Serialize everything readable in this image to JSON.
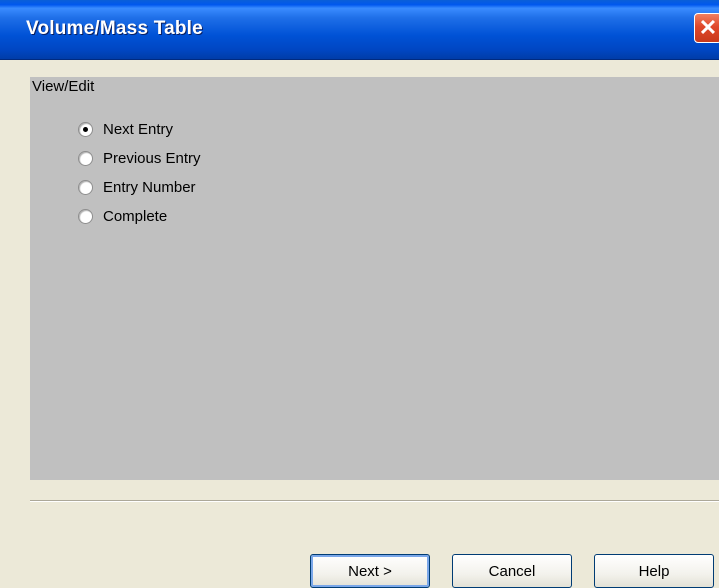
{
  "window": {
    "title": "Volume/Mass Table",
    "close_glyph": "✕"
  },
  "group": {
    "label": "View/Edit",
    "options": [
      {
        "label": "Next Entry",
        "checked": true
      },
      {
        "label": "Previous Entry",
        "checked": false
      },
      {
        "label": "Entry Number",
        "checked": false
      },
      {
        "label": "Complete",
        "checked": false
      }
    ]
  },
  "buttons": {
    "next": "Next >",
    "cancel": "Cancel",
    "help": "Help"
  }
}
